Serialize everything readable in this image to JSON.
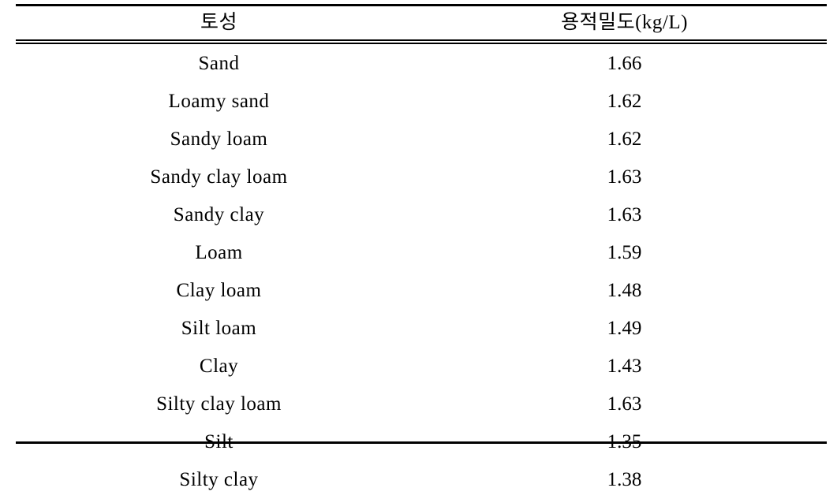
{
  "table": {
    "headers": [
      "토성",
      "용적밀도(kg/L)"
    ],
    "rows": [
      {
        "texture": "Sand",
        "density": "1.66"
      },
      {
        "texture": "Loamy sand",
        "density": "1.62"
      },
      {
        "texture": "Sandy loam",
        "density": "1.62"
      },
      {
        "texture": "Sandy clay loam",
        "density": "1.63"
      },
      {
        "texture": "Sandy clay",
        "density": "1.63"
      },
      {
        "texture": "Loam",
        "density": "1.59"
      },
      {
        "texture": "Clay loam",
        "density": "1.48"
      },
      {
        "texture": "Silt loam",
        "density": "1.49"
      },
      {
        "texture": "Clay",
        "density": "1.43"
      },
      {
        "texture": "Silty clay loam",
        "density": "1.63"
      },
      {
        "texture": "Silt",
        "density": "1.35"
      },
      {
        "texture": "Silty clay",
        "density": "1.38"
      }
    ]
  }
}
